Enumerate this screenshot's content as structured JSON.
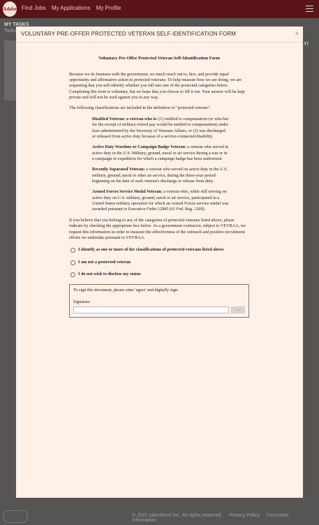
{
  "nav": {
    "logo_text": "Adobe",
    "items": [
      "Find Jobs",
      "My Applications",
      "My Profile"
    ]
  },
  "background": {
    "tasks_title": "MY TASKS",
    "tasks_sub": "Tasks",
    "right_text": "Y!",
    "footer_links": [
      "© 2022 talentReef Inc. All rights reserved.",
      "Privacy Policy",
      "Consumer Information"
    ]
  },
  "modal": {
    "title": "VOLUNTARY PRE-OFFER PROTECTED VETERAN SELF-IDENTIFICATION FORM",
    "close": "×",
    "form_heading": "Voluntary Pre-Offer Protected Veteran Self-Identification Form",
    "intro": "Because we do business with the government, we much reach out to, hire, and provide equal opportunity and affirmative action to protected veterans. To help measure how we are doing, we are requesting that you self-identify whether you fall into one of the protected categories below. Completing this form is voluntary, but we hope that you choose to fill it out. Your answer will be kept private and will not be used against you in any way.",
    "classifications_intro": "The following classifications are included in the definition of \"protected veteran\":",
    "classifications": [
      {
        "term": "Disabled Veteran: a veteran who is:",
        "text": " (1) entitled to compensation (or who but for the receipt of military retired pay would be entitled to compensation) under laws administered by the Secretary of Veterans Affairs, or (2) was discharged or released from active duty because of a service-connected disability."
      },
      {
        "term": "Active Duty Wartime or Campaign Badge Veteran:",
        "text": " a veteran who served in active duty in the U.S. Military, ground, naval or air service during a war or in a campaign or expedition for which a campaign badge has been authorized."
      },
      {
        "term": "Recently Separated Veteran:",
        "text": " a veteran who served on active duty in the U.S. military, ground, naval or other air service, during the three-year period beginning on the date of such veteran's discharge or release from duty."
      },
      {
        "term": "Armed Forces Service Medal Veteran:",
        "text": " a veteran who, while still serving on active duty on U.S. military, ground, naval or air service, participated in a United States military operation for which an Armed Forces service medal was awarded pursuant to Executive Order 12985 (61 Fed. Reg. 1209)."
      }
    ],
    "closing": "If you believe that you belong to any of the categories of protected veterans listed above, please indicate by checking the appropriate box below. As a government contractor, subject to VEVRAA, we request this information in order to measure the effectiveness of the outreach and positive recruitment efforts we undertake pursuant to VEVRAA.",
    "options": [
      "I identify as one or more of the classifications of protected veterans listed above",
      "I am not a protected veteran",
      "I do not wish to disclose my status"
    ],
    "sign_instruction": "To sign this document, please enter 'agree' and digitally sign:",
    "signature_label": "Signature",
    "signature_value": "",
    "sign_button": "Sign"
  }
}
